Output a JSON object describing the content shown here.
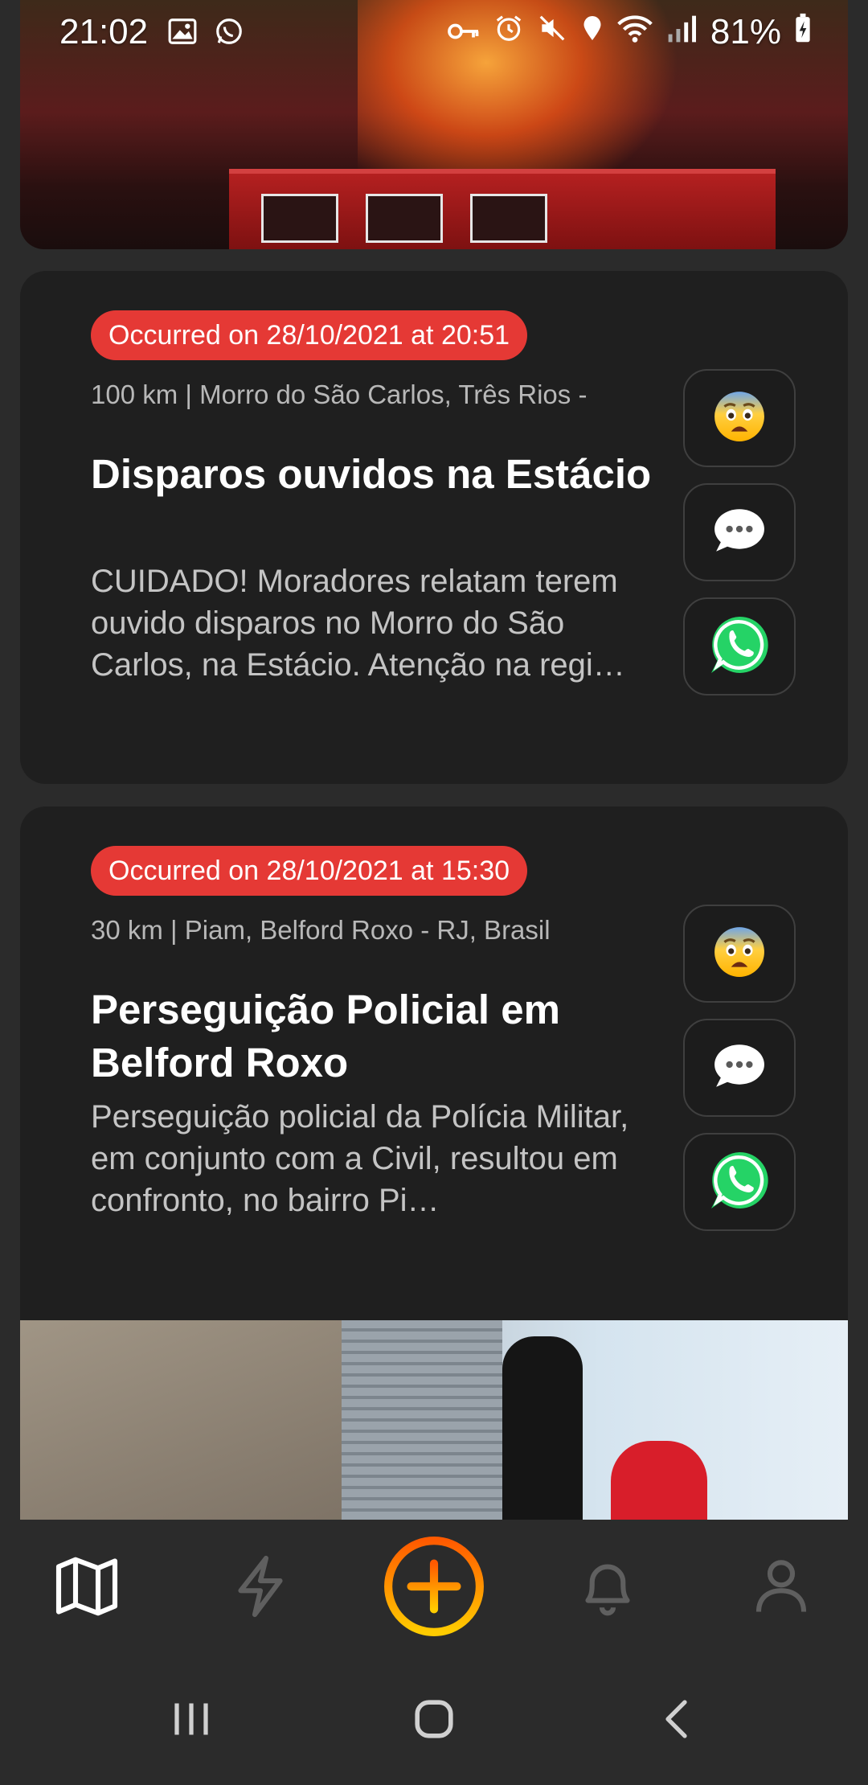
{
  "status_bar": {
    "time": "21:02",
    "battery": "81%"
  },
  "feed": {
    "cards": [
      {
        "occurred": "Occurred on 28/10/2021 at 20:51",
        "location": "100 km | Morro do São Carlos, Três Rios -",
        "title": "Disparos ouvidos na Estácio",
        "description": "CUIDADO! Moradores relatam terem ouvido disparos no Morro do São Carlos, na Estácio. Atenção na regi…"
      },
      {
        "occurred": "Occurred on 28/10/2021 at 15:30",
        "location": "30 km | Piam, Belford Roxo - RJ, Brasil",
        "title": "Perseguição Policial em Belford Roxo",
        "description": "Perseguição policial da Polícia Militar, em conjunto com a Civil, resultou em confronto, no bairro Pi…"
      }
    ]
  },
  "actions": {
    "icons": [
      "fearful-emoji-icon",
      "comment-bubble-icon",
      "whatsapp-icon"
    ]
  },
  "bottom_nav": {
    "items": [
      "map-icon",
      "lightning-icon",
      "add-icon",
      "bell-icon",
      "user-icon"
    ],
    "active": "map-icon"
  },
  "colors": {
    "background": "#2b2b2b",
    "card": "#1f1f1f",
    "badge": "#e53935",
    "accent_orange": "#ff6a00",
    "accent_yellow": "#ffcc00",
    "whatsapp": "#25d366"
  }
}
